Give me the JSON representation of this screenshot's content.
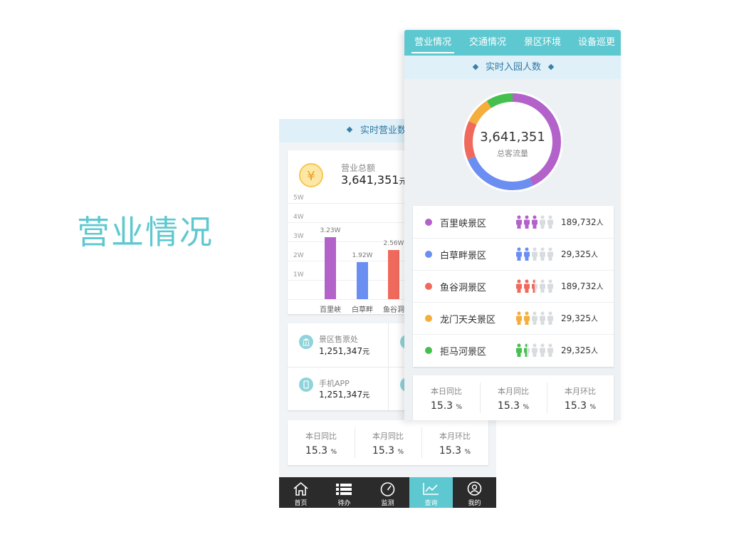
{
  "heading": "营业情况",
  "back": {
    "title": "实时营业数",
    "revenue": {
      "label": "营业总额",
      "value": "3,641,351",
      "unit": "元",
      "icon": "yen-icon",
      "icon_glyph": "¥"
    },
    "chart_data": {
      "type": "bar",
      "categories": [
        "百里峡",
        "白草畔",
        "鱼谷洞"
      ],
      "values": [
        3.23,
        1.92,
        2.56
      ],
      "value_labels": [
        "3.23W",
        "1.92W",
        "2.56W"
      ],
      "colors": [
        "#b262c9",
        "#6b8ef2",
        "#ef6a5c"
      ],
      "yticks": [
        "5W",
        "4W",
        "3W",
        "2W",
        "1W"
      ],
      "ylim": [
        0,
        5
      ],
      "grid": true
    },
    "sales": [
      {
        "label": "景区售票处",
        "value": "1,251,347",
        "unit": "元",
        "icon": "building-icon"
      },
      {
        "label": "手机APP",
        "value": "1,251,347",
        "unit": "元",
        "icon": "phone-icon"
      }
    ],
    "ratios": [
      {
        "label": "本日同比",
        "value": "15.3",
        "unit": "%"
      },
      {
        "label": "本月同比",
        "value": "15.3",
        "unit": "%"
      },
      {
        "label": "本月环比",
        "value": "15.3",
        "unit": "%"
      }
    ],
    "tabbar": [
      {
        "label": "首页",
        "icon": "home-icon"
      },
      {
        "label": "待办",
        "icon": "list-icon"
      },
      {
        "label": "监测",
        "icon": "gauge-icon"
      },
      {
        "label": "查询",
        "icon": "chart-icon",
        "active": true
      },
      {
        "label": "我的",
        "icon": "user-icon"
      }
    ]
  },
  "front": {
    "tabs": [
      "营业情况",
      "交通情况",
      "景区环境",
      "设备巡更"
    ],
    "subtitle": "实时入园人数",
    "total": {
      "value": "3,641,351",
      "label": "总客流量"
    },
    "donut": [
      {
        "color": "#b262c9",
        "value": 0.43
      },
      {
        "color": "#6b8ef2",
        "value": 0.26
      },
      {
        "color": "#ef6a5c",
        "value": 0.13
      },
      {
        "color": "#f5ad3b",
        "value": 0.09
      },
      {
        "color": "#45c04e",
        "value": 0.09
      }
    ],
    "spots": [
      {
        "name": "百里峡景区",
        "count": "189,732",
        "unit": "人",
        "color": "#b262c9",
        "filled": 3
      },
      {
        "name": "白草畔景区",
        "count": "29,325",
        "unit": "人",
        "color": "#6b8ef2",
        "filled": 2
      },
      {
        "name": "鱼谷洞景区",
        "count": "189,732",
        "unit": "人",
        "color": "#ef6a5c",
        "filled": 2.5
      },
      {
        "name": "龙门天关景区",
        "count": "29,325",
        "unit": "人",
        "color": "#f5ad3b",
        "filled": 2
      },
      {
        "name": "拒马河景区",
        "count": "29,325",
        "unit": "人",
        "color": "#45c04e",
        "filled": 1.5
      }
    ],
    "ratios": [
      {
        "label": "本日同比",
        "value": "15.3",
        "unit": "%"
      },
      {
        "label": "本月同比",
        "value": "15.3",
        "unit": "%"
      },
      {
        "label": "本月环比",
        "value": "15.3",
        "unit": "%"
      }
    ]
  }
}
